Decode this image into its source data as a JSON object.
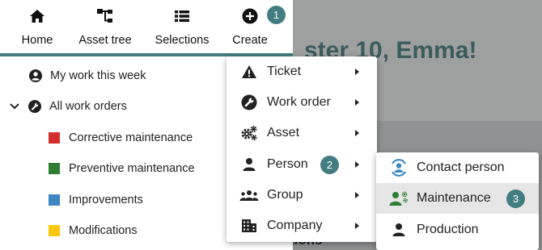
{
  "background": {
    "greeting": "ster 10, Emma!",
    "section_fragment": "tions"
  },
  "topbar": {
    "tabs": [
      {
        "label": "Home",
        "icon": "home-icon"
      },
      {
        "label": "Asset tree",
        "icon": "asset-tree-icon"
      },
      {
        "label": "Selections",
        "icon": "list-icon"
      },
      {
        "label": "Create",
        "icon": "plus-circle-icon"
      }
    ],
    "badge": "1"
  },
  "sidebar": {
    "my_work": "My work this week",
    "all_work_orders": "All work orders",
    "items": [
      {
        "label": "Corrective maintenance",
        "color": "#d32f2f"
      },
      {
        "label": "Preventive maintenance",
        "color": "#2e7d32"
      },
      {
        "label": "Improvements",
        "color": "#3f88c5"
      },
      {
        "label": "Modifications",
        "color": "#f9c80e"
      }
    ]
  },
  "create_menu": {
    "items": [
      {
        "label": "Ticket",
        "icon": "warning-icon"
      },
      {
        "label": "Work order",
        "icon": "wrench-icon"
      },
      {
        "label": "Asset",
        "icon": "gears-icon"
      },
      {
        "label": "Person",
        "icon": "person-icon"
      },
      {
        "label": "Group",
        "icon": "group-icon"
      },
      {
        "label": "Company",
        "icon": "building-icon"
      }
    ],
    "badge": "2"
  },
  "person_submenu": {
    "items": [
      {
        "label": "Contact person",
        "icon": "contact-person-icon"
      },
      {
        "label": "Maintenance",
        "icon": "maintenance-person-icon"
      },
      {
        "label": "Production",
        "icon": "person-icon"
      }
    ],
    "badge": "3",
    "accent": "#437d81",
    "maintenance_icon_color": "#2e7d32",
    "contact_icon_color": "#3f88c5"
  }
}
